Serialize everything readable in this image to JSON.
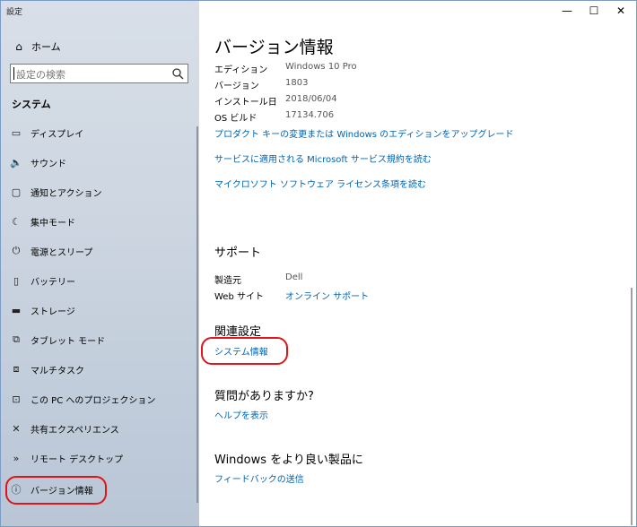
{
  "window": {
    "title": "設定",
    "controls": {
      "minimize": "—",
      "maximize": "☐",
      "close": "✕"
    }
  },
  "sidebar": {
    "home_label": "ホーム",
    "search_placeholder": "設定の検索",
    "section_label": "システム",
    "items": [
      {
        "label": "ディスプレイ",
        "icon": "display-icon"
      },
      {
        "label": "サウンド",
        "icon": "sound-icon"
      },
      {
        "label": "通知とアクション",
        "icon": "notification-icon"
      },
      {
        "label": "集中モード",
        "icon": "moon-icon"
      },
      {
        "label": "電源とスリープ",
        "icon": "power-icon"
      },
      {
        "label": "バッテリー",
        "icon": "battery-icon"
      },
      {
        "label": "ストレージ",
        "icon": "storage-icon"
      },
      {
        "label": "タブレット モード",
        "icon": "tablet-icon"
      },
      {
        "label": "マルチタスク",
        "icon": "multitask-icon"
      },
      {
        "label": "この PC へのプロジェクション",
        "icon": "projection-icon"
      },
      {
        "label": "共有エクスペリエンス",
        "icon": "shared-icon"
      },
      {
        "label": "リモート デスクトップ",
        "icon": "remote-icon"
      },
      {
        "label": "バージョン情報",
        "icon": "info-icon"
      }
    ]
  },
  "main": {
    "title": "バージョン情報",
    "specs": [
      {
        "key": "エディション",
        "value": "Windows 10 Pro"
      },
      {
        "key": "バージョン",
        "value": "1803"
      },
      {
        "key": "インストール日",
        "value": "2018/06/04"
      },
      {
        "key": "OS ビルド",
        "value": "17134.706"
      }
    ],
    "links": [
      "プロダクト キーの変更または Windows のエディションをアップグレード",
      "サービスに適用される Microsoft サービス規約を読む",
      "マイクロソフト ソフトウェア ライセンス条項を読む"
    ],
    "support": {
      "heading": "サポート",
      "manufacturer_key": "製造元",
      "manufacturer_value": "Dell",
      "website_key": "Web サイト",
      "website_value": "オンライン サポート"
    },
    "related": {
      "heading": "関連設定",
      "link": "システム情報"
    },
    "question": {
      "heading": "質問がありますか?",
      "link": "ヘルプを表示"
    },
    "improve": {
      "heading": "Windows をより良い製品に",
      "link": "フィードバックの送信"
    }
  },
  "colors": {
    "accent_link": "#0063b1",
    "annotation_red": "#e0141a"
  }
}
